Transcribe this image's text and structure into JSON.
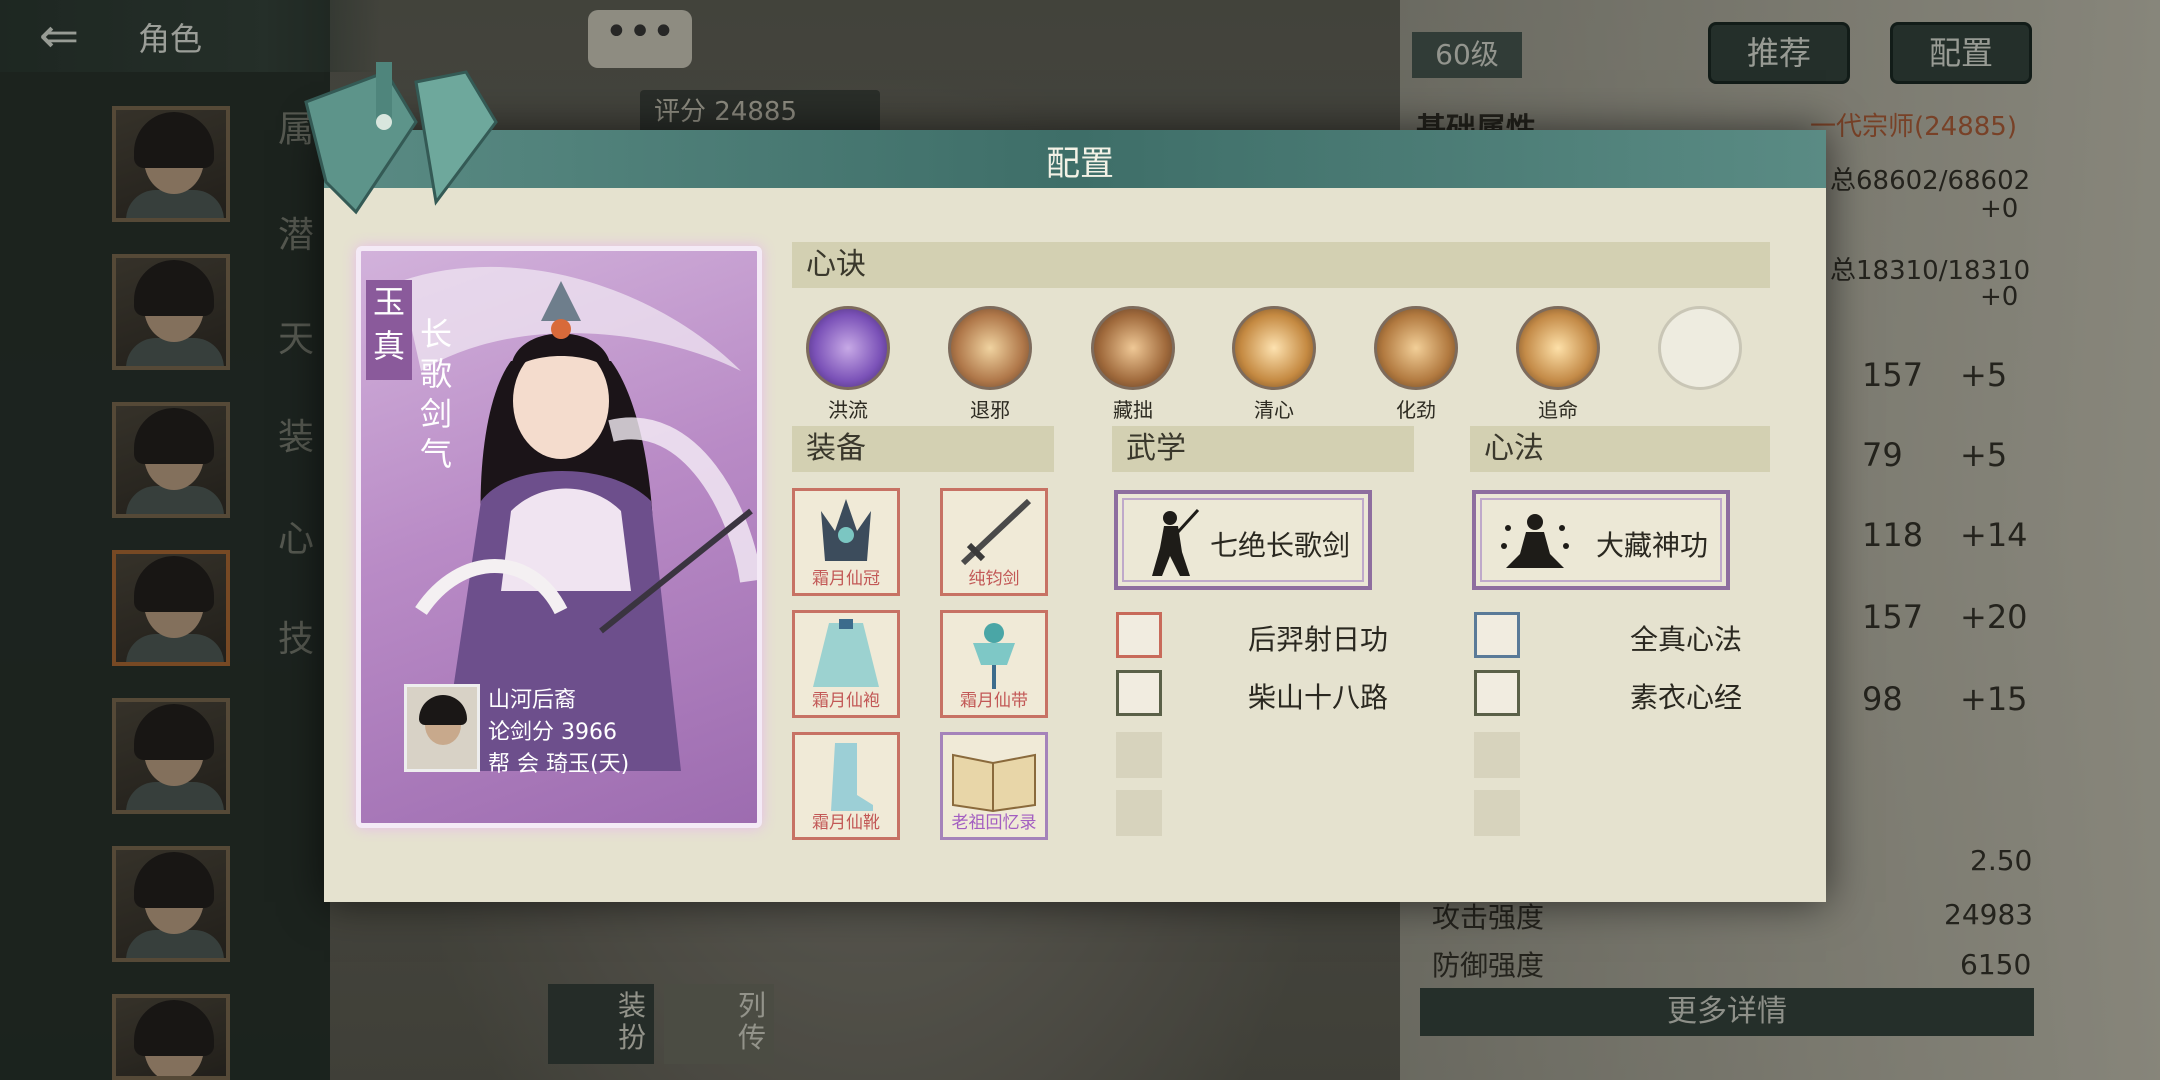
{
  "header": {
    "back_icon": "back-arrow-icon",
    "title": "角色"
  },
  "background": {
    "side_tabs": [
      "属性",
      "潜",
      "天",
      "装",
      "心",
      "技"
    ],
    "score_label": "评分",
    "score_value": "24885",
    "level": "60级",
    "buttons": {
      "recommend": "推荐",
      "config": "配置"
    },
    "base_attrs_title": "基础属性",
    "title_honor": "一代宗师(24885)",
    "hp": "总68602/68602",
    "hp_bonus": "+0",
    "mp": "总18310/18310",
    "mp_bonus": "+0",
    "stats": [
      {
        "value": "157",
        "bonus": "+5"
      },
      {
        "value": "79",
        "bonus": "+5"
      },
      {
        "value": "118",
        "bonus": "+14"
      },
      {
        "value": "157",
        "bonus": "+20"
      },
      {
        "value": "98",
        "bonus": "+15"
      }
    ],
    "misc_value": "2.50",
    "attack_label": "攻击强度",
    "attack_value": "24983",
    "defense_label": "防御强度",
    "defense_value": "6150",
    "more_details": "更多详情",
    "bottom_tabs": {
      "dress": "装扮",
      "bio": "列传"
    }
  },
  "modal": {
    "title": "配置",
    "card": {
      "name": "玉真",
      "skill": "长歌剑气",
      "owner_name": "山河后裔",
      "owner_score_label": "论剑分",
      "owner_score": "3966",
      "owner_guild_label": "帮 会",
      "owner_guild": "琦玉(天)"
    },
    "xinjue": {
      "header": "心诀",
      "items": [
        {
          "label": "洪流",
          "color": "#7b52b8"
        },
        {
          "label": "退邪",
          "color": "#b0784a"
        },
        {
          "label": "藏拙",
          "color": "#a06a3c"
        },
        {
          "label": "清心",
          "color": "#c58a42"
        },
        {
          "label": "化劲",
          "color": "#b27a40"
        },
        {
          "label": "追命",
          "color": "#c48b48"
        }
      ]
    },
    "zhuangbei": {
      "header": "装备",
      "items": [
        {
          "label": "霜月仙冠",
          "icon": "crown-icon"
        },
        {
          "label": "纯钧剑",
          "icon": "sword-icon"
        },
        {
          "label": "霜月仙袍",
          "icon": "robe-icon"
        },
        {
          "label": "霜月仙带",
          "icon": "belt-icon"
        },
        {
          "label": "霜月仙靴",
          "icon": "boots-icon"
        },
        {
          "label": "老祖回忆录",
          "icon": "book-icon"
        }
      ]
    },
    "wuxue": {
      "header": "武学",
      "main": "七绝长歌剑",
      "subs": [
        "后羿射日功",
        "柴山十八路"
      ]
    },
    "xinfa": {
      "header": "心法",
      "main": "大藏神功",
      "subs": [
        "全真心法",
        "素衣心经"
      ]
    }
  }
}
